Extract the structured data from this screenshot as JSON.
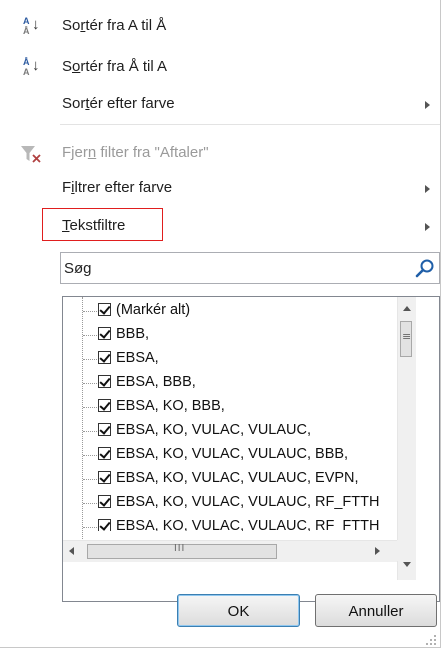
{
  "menu": {
    "sort_asc": {
      "pre": "So",
      "acc": "r",
      "post": "tér fra A til Å",
      "icon": "sort-ascending-icon",
      "icon_top": "A",
      "icon_bottom": "Å"
    },
    "sort_desc": {
      "pre": "S",
      "acc": "o",
      "post": "rtér fra Å til A",
      "icon": "sort-descending-icon",
      "icon_top": "Å",
      "icon_bottom": "A"
    },
    "sort_color": {
      "pre": "Sor",
      "acc": "t",
      "post": "ér efter farve"
    },
    "clear_filter": {
      "pre": "Fjer",
      "acc": "n",
      "post": " filter fra \"Aftaler\"",
      "icon": "clear-filter-icon"
    },
    "filter_color": {
      "pre": "F",
      "acc": "i",
      "post": "ltrer efter farve"
    },
    "text_filters": {
      "pre": "",
      "acc": "T",
      "post": "ekstfiltre"
    }
  },
  "search": {
    "value": "Søg",
    "icon": "search-icon"
  },
  "list": {
    "items": [
      "(Markér alt)",
      "BBB,",
      "EBSA,",
      "EBSA, BBB,",
      "EBSA, KO, BBB,",
      "EBSA, KO, VULAC, VULAUC,",
      "EBSA, KO, VULAC, VULAUC, BBB,",
      "EBSA, KO, VULAC, VULAUC, EVPN,",
      "EBSA, KO, VULAC, VULAUC, RF_FTTH",
      "EBSA, KO, VULAC, VULAUC, RF_FTTH"
    ],
    "scroll_grip": "III"
  },
  "buttons": {
    "ok": "OK",
    "cancel": "Annuller"
  },
  "colors": {
    "highlight_border": "#e01e1e",
    "checked": "#111111",
    "disabled_text": "#9a9a9a"
  }
}
